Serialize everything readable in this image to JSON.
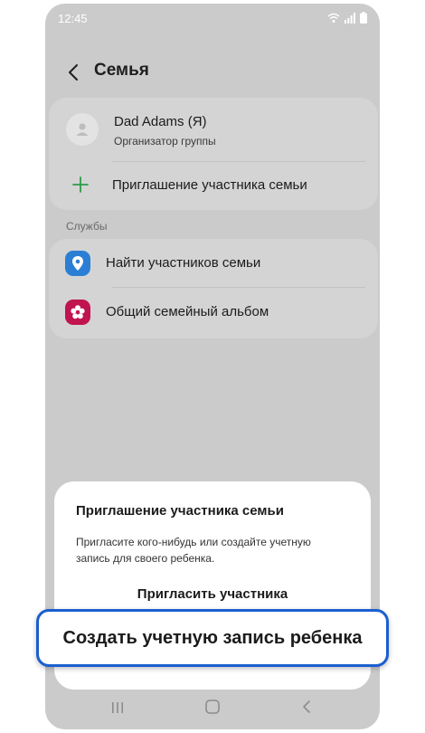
{
  "status_bar": {
    "time": "12:45"
  },
  "header": {
    "title": "Семья"
  },
  "family": {
    "member": {
      "name": "Dad Adams (Я)",
      "role": "Организатор группы"
    },
    "invite_label": "Приглашение участника семьи"
  },
  "services": {
    "section_label": "Службы",
    "items": [
      {
        "label": "Найти участников семьи",
        "icon": "find-location-icon",
        "color": "#2a7fd4"
      },
      {
        "label": "Общий семейный альбом",
        "icon": "flower-icon",
        "color": "#c0134f"
      }
    ]
  },
  "sheet": {
    "title": "Приглашение участника семьи",
    "description": "Пригласите кого-нибудь или создайте учетную запись для своего ребенка.",
    "invite_button": "Пригласить участника",
    "create_child_button": "Создать учетную запись ребенка"
  },
  "colors": {
    "highlight_border": "#1a5fcf",
    "accent_green": "#2e9b48"
  }
}
